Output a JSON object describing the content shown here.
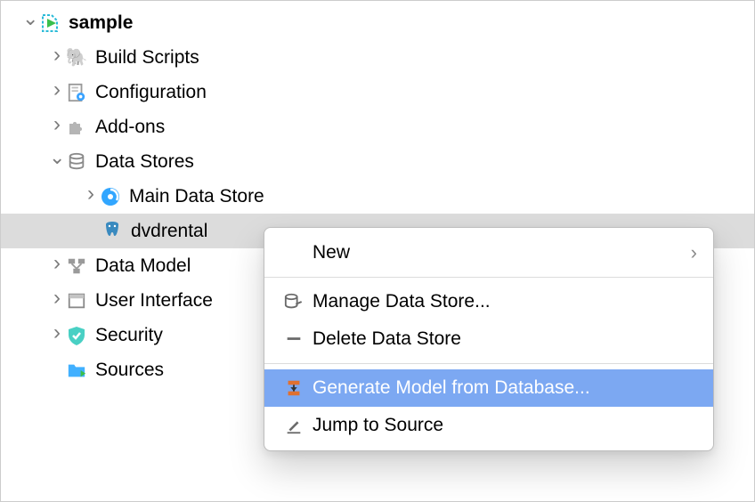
{
  "tree": {
    "root": {
      "label": "sample"
    },
    "buildScripts": {
      "label": "Build Scripts"
    },
    "configuration": {
      "label": "Configuration"
    },
    "addons": {
      "label": "Add-ons"
    },
    "dataStores": {
      "label": "Data Stores"
    },
    "mainDataStore": {
      "label": "Main Data Store"
    },
    "dvdrental": {
      "label": "dvdrental"
    },
    "dataModel": {
      "label": "Data Model"
    },
    "userInterface": {
      "label": "User Interface"
    },
    "security": {
      "label": "Security"
    },
    "sources": {
      "label": "Sources"
    }
  },
  "contextMenu": {
    "new": "New",
    "manageDataStore": "Manage Data Store...",
    "deleteDataStore": "Delete Data Store",
    "generateModel": "Generate Model from Database...",
    "jumpToSource": "Jump to Source"
  }
}
